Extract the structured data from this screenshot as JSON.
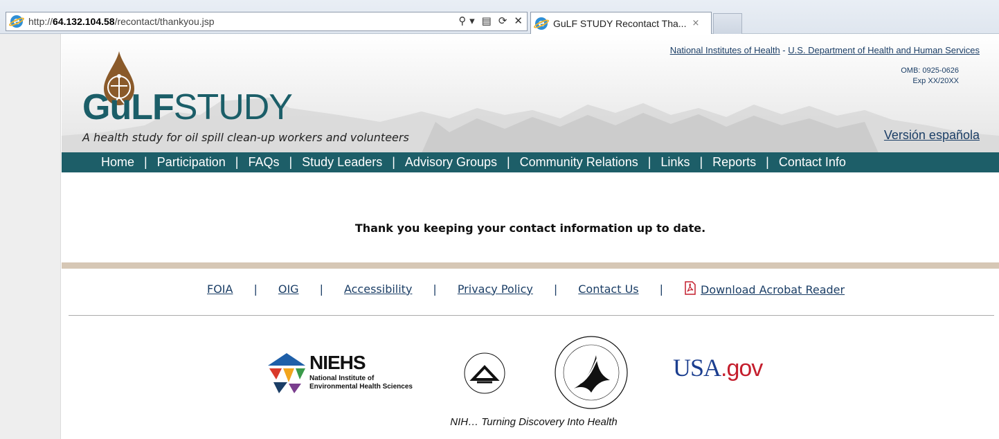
{
  "browser": {
    "url_prefix": "http://",
    "url_host": "64.132.104.58",
    "url_path": "/recontact/thankyou.jsp",
    "tab_title": "GuLF STUDY Recontact Tha...",
    "tab_close": "×",
    "search_glyph": "⚲ ▾",
    "refresh_glyph": "⟳",
    "close_glyph": "✕"
  },
  "header": {
    "logo_bold": "GuLF",
    "logo_light": "STUDY",
    "tagline": "A health study for oil spill clean-up workers and volunteers",
    "nih_link": "National Institutes of Health",
    "link_sep": " - ",
    "hhs_link": "U.S. Department of Health and Human Services",
    "omb_line1": "OMB: 0925-0626",
    "omb_line2": "Exp XX/20XX",
    "spanish_link": "Versión española"
  },
  "nav": {
    "items": [
      "Home",
      "Participation",
      "FAQs",
      "Study Leaders",
      "Advisory Groups",
      "Community Relations",
      "Links",
      "Reports",
      "Contact Info"
    ],
    "separator": "|"
  },
  "main": {
    "message": "Thank you keeping your contact information up to date."
  },
  "footer": {
    "links": [
      "FOIA",
      "OIG",
      "Accessibility",
      "Privacy Policy",
      "Contact Us"
    ],
    "acrobat_link": "Download Acrobat Reader",
    "separator": "|",
    "niehs_title": "NIEHS",
    "niehs_sub1": "National Institute of",
    "niehs_sub2": "Environmental Health Sciences",
    "usa": "USA",
    "gov": ".gov",
    "tagline": "NIH… Turning Discovery Into Health"
  },
  "colors": {
    "brand_teal": "#1d5e68",
    "link_blue": "#1b3e66",
    "rule_tan": "#d6c7b5"
  }
}
